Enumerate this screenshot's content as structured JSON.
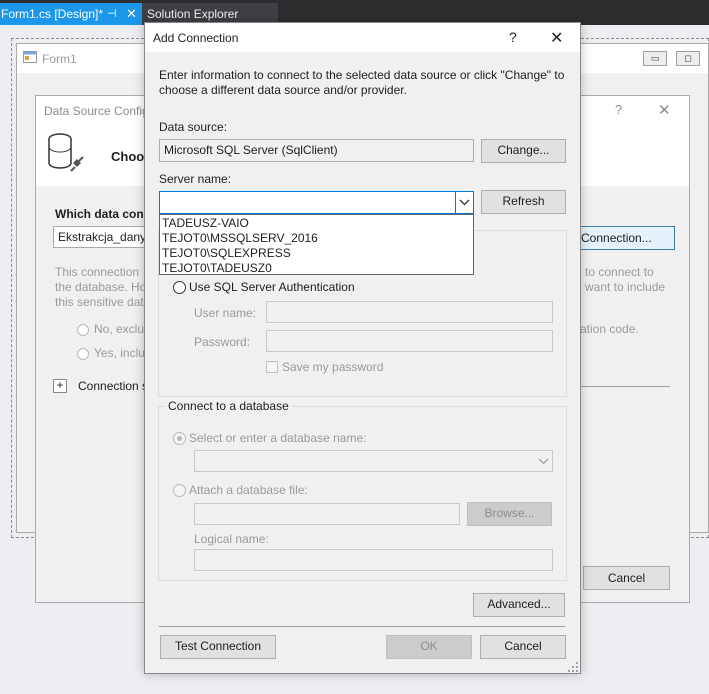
{
  "vs_tabs": {
    "active": {
      "label": "Form1.cs [Design]*",
      "pin_icon": "pin-icon",
      "close_icon": "close-icon"
    },
    "inactive": {
      "label": "Solution Explorer"
    }
  },
  "form1": {
    "title": "Form1"
  },
  "wizard": {
    "title": "Data Source Configuration Wizard",
    "title_visible": "Data Source Config",
    "help": "?",
    "close": "✕",
    "heading_visible": "Choo",
    "which_label_visible": "Which data conn",
    "connection_combo_visible": "Ekstrakcja_danyc",
    "new_connection_visible": "Connection...",
    "info_left_1": "This connection",
    "info_left_2": "the database. Ho",
    "info_left_3": "this sensitive dat",
    "info_right_1": "to connect to",
    "info_right_2": "want to include",
    "info_right_3": "ation code.",
    "radio_no_visible": "No, exclu",
    "radio_yes_visible": "Yes, inclu",
    "expander": "+",
    "connection_string_visible": "Connection s",
    "cancel": "Cancel"
  },
  "add_connection": {
    "title": "Add Connection",
    "help": "?",
    "close": "✕",
    "intro": "Enter information to connect to the selected data source or click \"Change\" to choose a different data source and/or provider.",
    "data_source_label": "Data source:",
    "data_source_value": "Microsoft SQL Server (SqlClient)",
    "change_button": "Change...",
    "server_name_label": "Server name:",
    "server_name_value": "",
    "refresh_button": "Refresh",
    "server_list": [
      "TADEUSZ-VAIO",
      "TEJOT0\\MSSQLSERV_2016",
      "TEJOT0\\SQLEXPRESS",
      "TEJOT0\\TADEUSZ0"
    ],
    "sql_auth_label": "Use SQL Server Authentication",
    "user_name_label": "User name:",
    "password_label": "Password:",
    "save_password_label": "Save my password",
    "connect_db_group": "Connect to a database",
    "select_db_label": "Select or enter a database name:",
    "attach_db_label": "Attach a database file:",
    "browse_button": "Browse...",
    "logical_name_label": "Logical name:",
    "advanced_button": "Advanced...",
    "test_connection_button": "Test Connection",
    "ok_button": "OK",
    "cancel_button": "Cancel"
  }
}
